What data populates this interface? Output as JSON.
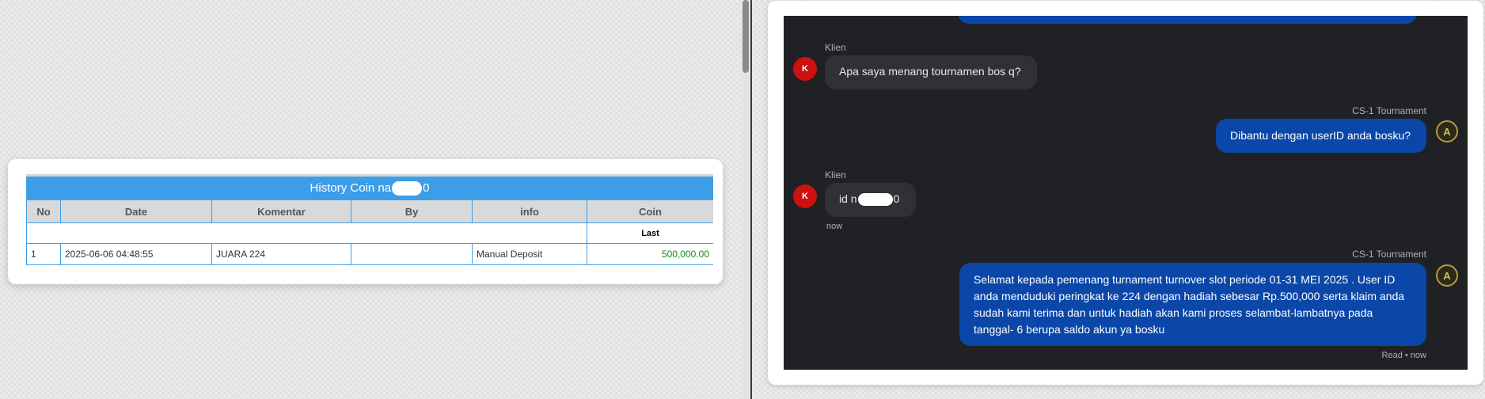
{
  "history_table": {
    "title_start": "History Coin na",
    "title_end": "0",
    "columns": [
      "No",
      "Date",
      "Komentar",
      "By",
      "info",
      "Coin"
    ],
    "subheader_last": "Last",
    "rows": [
      {
        "no": "1",
        "date": "2025-06-06 04:48:55",
        "komentar": "JUARA 224",
        "by": "",
        "info": "Manual Deposit",
        "coin": "500,000.00"
      }
    ]
  },
  "chat": {
    "messages": [
      {
        "sender": "Klien",
        "avatar": "K",
        "text": "Apa saya menang tournamen bos q?"
      },
      {
        "sender": "CS-1 Tournament",
        "avatar": "A",
        "text": "Dibantu dengan userID anda bosku?"
      },
      {
        "sender": "Klien",
        "avatar": "K",
        "text_start": "id n",
        "text_end": "0",
        "time": "now"
      },
      {
        "sender": "CS-1 Tournament",
        "avatar": "A",
        "text": "Selamat kepada pemenang turnament turnover slot periode 01-31 MEI 2025 . User ID anda menduduki peringkat ke 224 dengan hadiah sebesar Rp.500,000 serta klaim anda sudah kami terima dan untuk hadiah akan kami proses selambat-lambatnya pada tanggal- 6 berupa saldo akun ya bosku",
        "status": "Read • now"
      }
    ]
  },
  "colors": {
    "table_header_blue": "#3d9ee8",
    "chat_background": "#202124",
    "outgoing_bubble": "#0b47a8",
    "incoming_bubble": "#303135",
    "client_avatar": "#cc1111",
    "amount_green": "#1a8a1a"
  }
}
